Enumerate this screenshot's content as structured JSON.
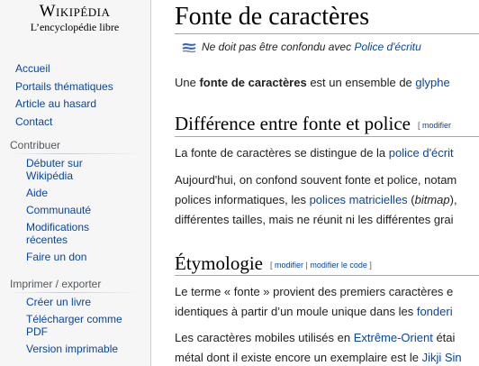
{
  "logo": {
    "title": "Wikipédia",
    "subtitle": "L’encyclopédie libre"
  },
  "nav_main": [
    "Accueil",
    "Portails thématiques",
    "Article au hasard",
    "Contact"
  ],
  "portal_contribute": {
    "heading": "Contribuer",
    "items": [
      "Débuter sur Wikipédia",
      "Aide",
      "Communauté",
      "Modifications récentes",
      "Faire un don"
    ]
  },
  "portal_export": {
    "heading": "Imprimer / exporter",
    "items": [
      "Créer un livre",
      "Télécharger comme PDF",
      "Version imprimable"
    ]
  },
  "article": {
    "title": "Fonte de caractères",
    "hatnote": {
      "text": "Ne doit pas être confondu avec ",
      "link": "Police d'écritu"
    },
    "intro": {
      "pre": "Une ",
      "bold": "fonte de caractères",
      "post": " est un ensemble de ",
      "link": "glyphe"
    },
    "section1": {
      "title": "Différence entre fonte et police",
      "edit_open": "[ ",
      "edit_label": "modifier",
      "p1": {
        "text": "La fonte de caractères se distingue de la ",
        "link": "police d'écrit"
      },
      "p2_line1": "Aujourd'hui, on confond souvent fonte et police, notam",
      "p2_line2": {
        "pre": "polices informatiques, les ",
        "link": "polices matricielles",
        "mid": " (",
        "italic": "bitmap",
        "post": "),"
      },
      "p2_line3": "différentes tailles, mais ne réunit ni les différentes grai"
    },
    "section2": {
      "title": "Étymologie",
      "edit_open": "[ ",
      "edit_label1": "modifier",
      "edit_sep": " | ",
      "edit_label2": "modifier le code",
      "edit_close": " ]",
      "p1_line1": "Le terme « fonte » provient des premiers caractères e",
      "p1_line2": {
        "text": "identiques à partir d’un moule unique dans les ",
        "link": "fonderi"
      },
      "p2_line1": {
        "text": "Les caractères mobiles utilisés en ",
        "link": "Extrême-Orient",
        "post": " étai"
      },
      "p2_line2": {
        "text": "métal dont il existe encore un exemplaire est le ",
        "link": "Jikji Sin"
      }
    }
  }
}
